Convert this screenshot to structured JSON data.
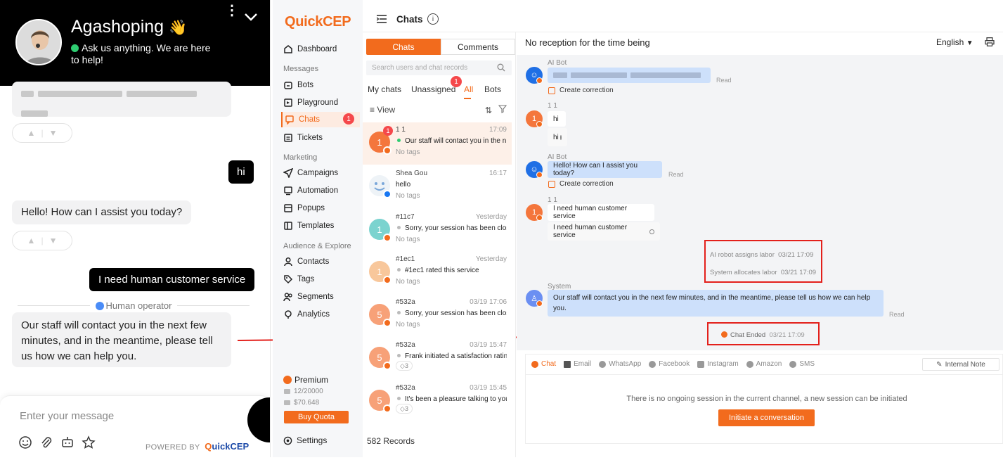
{
  "widget": {
    "brand_name": "Agashoping",
    "wave_emoji": "👋",
    "status_text": "Ask us anything. We are here to help!",
    "messages": [
      {
        "side": "right",
        "text": "hi"
      },
      {
        "side": "left",
        "text": "Hello! How can I assist you today?"
      },
      {
        "side": "right",
        "text": "I need human customer service"
      },
      {
        "side": "left",
        "text": "Our staff will contact you in the next few minutes, and in the meantime, please tell us how we can help you."
      }
    ],
    "operator_divider": "Human operator",
    "input_placeholder": "Enter your message",
    "powered_by": "POWERED BY",
    "powered_brand_q": "Q",
    "powered_brand_rest": "uick",
    "powered_brand_cep": "CEP"
  },
  "app": {
    "logo_q": "Q",
    "logo_uick": "uick",
    "logo_cep": "CEP",
    "page_title": "Chats",
    "info_glyph": "i"
  },
  "sidebar": {
    "dashboard": "Dashboard",
    "section_messages": "Messages",
    "bots": "Bots",
    "playground": "Playground",
    "chats": "Chats",
    "chats_badge": "1",
    "tickets": "Tickets",
    "section_marketing": "Marketing",
    "campaigns": "Campaigns",
    "automation": "Automation",
    "popups": "Popups",
    "templates": "Templates",
    "section_audience": "Audience & Explore",
    "contacts": "Contacts",
    "tags": "Tags",
    "segments": "Segments",
    "analytics": "Analytics",
    "premium": "Premium",
    "quota_messages": "12/20000",
    "quota_money": "$70.648",
    "buy_quota": "Buy Quota",
    "settings": "Settings"
  },
  "chatlist": {
    "tab_chats": "Chats",
    "tab_comments": "Comments",
    "search_placeholder": "Search users and chat records",
    "filter_my": "My chats",
    "filter_unassigned": "Unassigned",
    "filter_unassigned_badge": "1",
    "filter_all": "All",
    "filter_bots": "Bots",
    "view": "View",
    "sort_glyph": "⇅",
    "records": "582 Records",
    "conversations": [
      {
        "name": "1 1",
        "time": "17:09",
        "message": "Our staff will contact you in the n",
        "tag": "No tags",
        "avatar": "1",
        "badge": "1",
        "dot": "green"
      },
      {
        "name": "Shea Gou",
        "time": "16:17",
        "message": "hello",
        "tag": "No tags",
        "avatar": "",
        "badge": "",
        "dot": "none"
      },
      {
        "name": "#11c7",
        "time": "Yesterday",
        "message": "Sorry, your session has been clos",
        "tag": "No tags",
        "avatar": "1",
        "badge": "",
        "dot": "grey"
      },
      {
        "name": "#1ec1",
        "time": "Yesterday",
        "message": "#1ec1 rated this service",
        "tag": "No tags",
        "avatar": "1",
        "badge": "",
        "dot": "grey"
      },
      {
        "name": "#532a",
        "time": "03/19 17:06",
        "message": "Sorry, your session has been clos",
        "tag": "No tags",
        "avatar": "5",
        "badge": "",
        "dot": "grey"
      },
      {
        "name": "#532a",
        "time": "03/19 15:47",
        "message": "Frank initiated a satisfaction ratin",
        "tag": "3",
        "avatar": "5",
        "badge": "",
        "dot": "grey"
      },
      {
        "name": "#532a",
        "time": "03/19 15:45",
        "message": "It's been a pleasure talking to you",
        "tag": "3",
        "avatar": "5",
        "badge": "",
        "dot": "grey"
      }
    ]
  },
  "conversation": {
    "header": "No reception for the time being",
    "language": "English",
    "language_caret": "▼",
    "sender_ai_bot": "AI Bot",
    "sender_user": "1 1",
    "sender_system": "System",
    "read": "Read",
    "create_correction": "Create correction",
    "msg_hi": "hi",
    "msg_hi_translated": "hi",
    "msg_bot_greeting": "Hello! How can I assist you today?",
    "msg_human": "I need human customer service",
    "msg_human_translated": "I need human customer service",
    "sys_assign_label": "AI robot assigns labor",
    "sys_assign_time": "03/21 17:09",
    "sys_allocate_label": "System allocates labor",
    "sys_allocate_time": "03/21 17:09",
    "msg_system": "Our staff will contact you in the next few minutes, and in the meantime, please tell us how we can help you.",
    "chat_ended": "Chat Ended",
    "chat_ended_time": "03/21 17:09",
    "avatar_user": "1"
  },
  "composer": {
    "channels": [
      "Chat",
      "Email",
      "WhatsApp",
      "Facebook",
      "Instagram",
      "Amazon",
      "SMS"
    ],
    "internal_note": "Internal Note",
    "no_session": "There is no ongoing session in the current channel, a new session can be initiated",
    "initiate": "Initiate a conversation"
  },
  "colors": {
    "accent": "#f26b1d",
    "brand_blue": "#1c4aa8",
    "annotation_red": "#e3201b"
  }
}
